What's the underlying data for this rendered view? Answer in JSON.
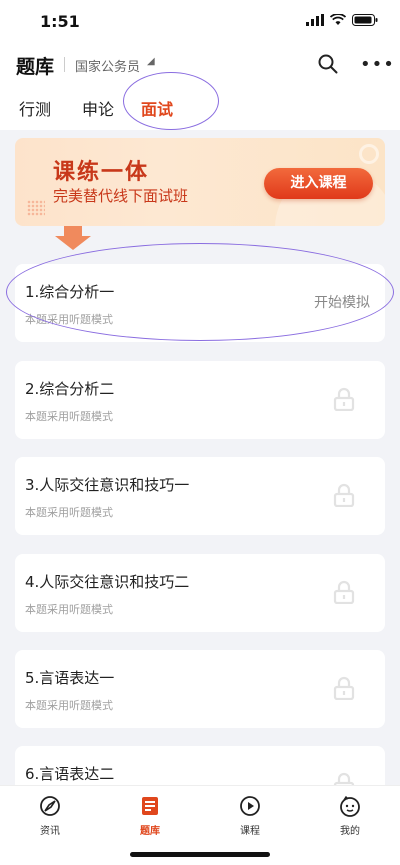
{
  "status_bar": {
    "time": "1:51"
  },
  "header": {
    "title": "题库",
    "subtitle": "国家公务员"
  },
  "tabs": [
    {
      "label": "行测"
    },
    {
      "label": "申论"
    },
    {
      "label": "面试"
    }
  ],
  "banner": {
    "title": "课练一体",
    "subtitle": "完美替代线下面试班",
    "button_label": "进入课程"
  },
  "questions": [
    {
      "title": "1.综合分析一",
      "mode": "本题采用听题模式",
      "action": "开始模拟",
      "locked": false
    },
    {
      "title": "2.综合分析二",
      "mode": "本题采用听题模式",
      "locked": true
    },
    {
      "title": "3.人际交往意识和技巧一",
      "mode": "本题采用听题模式",
      "locked": true
    },
    {
      "title": "4.人际交往意识和技巧二",
      "mode": "本题采用听题模式",
      "locked": true
    },
    {
      "title": "5.言语表达一",
      "mode": "本题采用听题模式",
      "locked": true
    },
    {
      "title": "6.言语表达二",
      "mode": "",
      "locked": true
    }
  ],
  "bottom_nav": [
    {
      "label": "资讯",
      "icon": "news-icon"
    },
    {
      "label": "题库",
      "icon": "question-bank-icon"
    },
    {
      "label": "课程",
      "icon": "play-icon"
    },
    {
      "label": "我的",
      "icon": "profile-icon"
    }
  ],
  "colors": {
    "accent": "#e0471d",
    "annotation": "#8a6de0"
  }
}
